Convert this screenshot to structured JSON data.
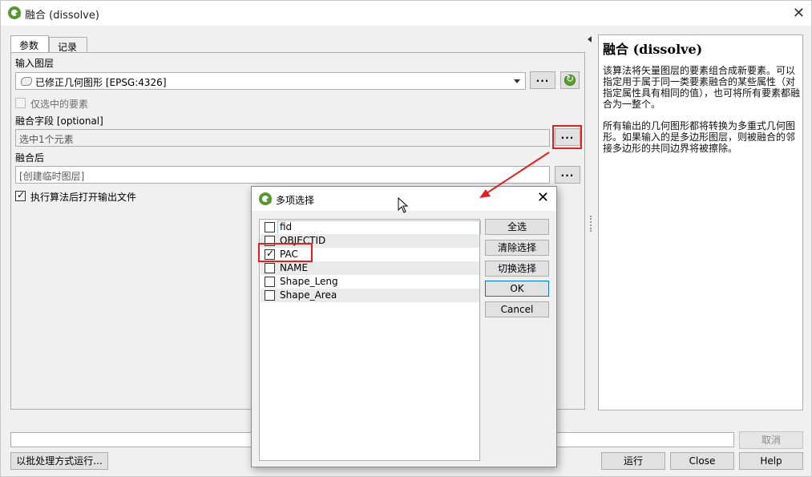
{
  "window": {
    "title": "融合 (dissolve)"
  },
  "tabs": [
    {
      "label": "参数",
      "active": true
    },
    {
      "label": "记录",
      "active": false
    }
  ],
  "params": {
    "input_layer_label": "输入图层",
    "input_layer_value": "已修正几何图形 [EPSG:4326]",
    "selected_only_label": "仅选中的要素",
    "dissolve_field_label": "融合字段 [optional]",
    "dissolve_field_value": "选中1个元素",
    "dissolved_label": "融合后",
    "dissolved_value": "[创建临时图层]",
    "open_output_label": "执行算法后打开输出文件",
    "dots": "..."
  },
  "help": {
    "title": "融合 (dissolve)",
    "para1": "该算法将矢量图层的要素组合成新要素。可以指定用于属于同一类要素融合的某些属性（对指定属性具有相同的值），也可将所有要素都融合为一整个。",
    "para2": "所有输出的几何图形都将转换为多重式几何图形。如果输入的是多边形图层，则被融合的邻接多边形的共同边界将被擦除。"
  },
  "bottom": {
    "cancel": "取消",
    "batch": "以批处理方式运行...",
    "run": "运行",
    "close": "Close",
    "help": "Help"
  },
  "dialog": {
    "title": "多项选择",
    "fields": [
      {
        "name": "fid",
        "checked": false
      },
      {
        "name": "OBJECTID",
        "checked": false
      },
      {
        "name": "PAC",
        "checked": true
      },
      {
        "name": "NAME",
        "checked": false
      },
      {
        "name": "Shape_Leng",
        "checked": false
      },
      {
        "name": "Shape_Area",
        "checked": false
      }
    ],
    "select_all": "全选",
    "clear_selection": "清除选择",
    "toggle_selection": "切换选择",
    "ok": "OK",
    "cancel": "Cancel"
  },
  "colors": {
    "accent_red": "#e02020",
    "qgis_green": "#589632",
    "selection_blue": "#9ccbee"
  }
}
